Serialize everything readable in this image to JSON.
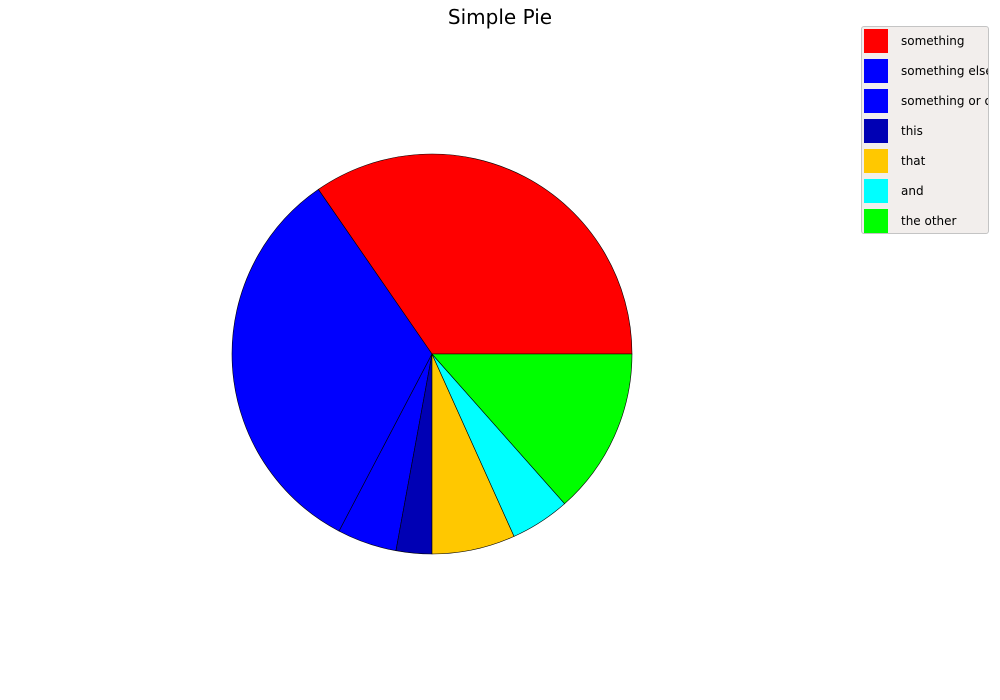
{
  "chart_data": {
    "type": "pie",
    "title": "Simple Pie",
    "legend_position": "top-right",
    "start_angle_deg": 0,
    "direction": "counterclockwise",
    "slices": [
      {
        "label": "something",
        "value": 36,
        "color": "#ff0000"
      },
      {
        "label": "something else",
        "value": 34,
        "color": "#0000ff"
      },
      {
        "label": "something or other",
        "value": 5,
        "color": "#0000ff"
      },
      {
        "label": "this",
        "value": 3,
        "color": "#0000b4"
      },
      {
        "label": "that",
        "value": 7,
        "color": "#ffc800"
      },
      {
        "label": "and",
        "value": 5,
        "color": "#00ffff"
      },
      {
        "label": "the other",
        "value": 14,
        "color": "#00ff00"
      }
    ]
  }
}
